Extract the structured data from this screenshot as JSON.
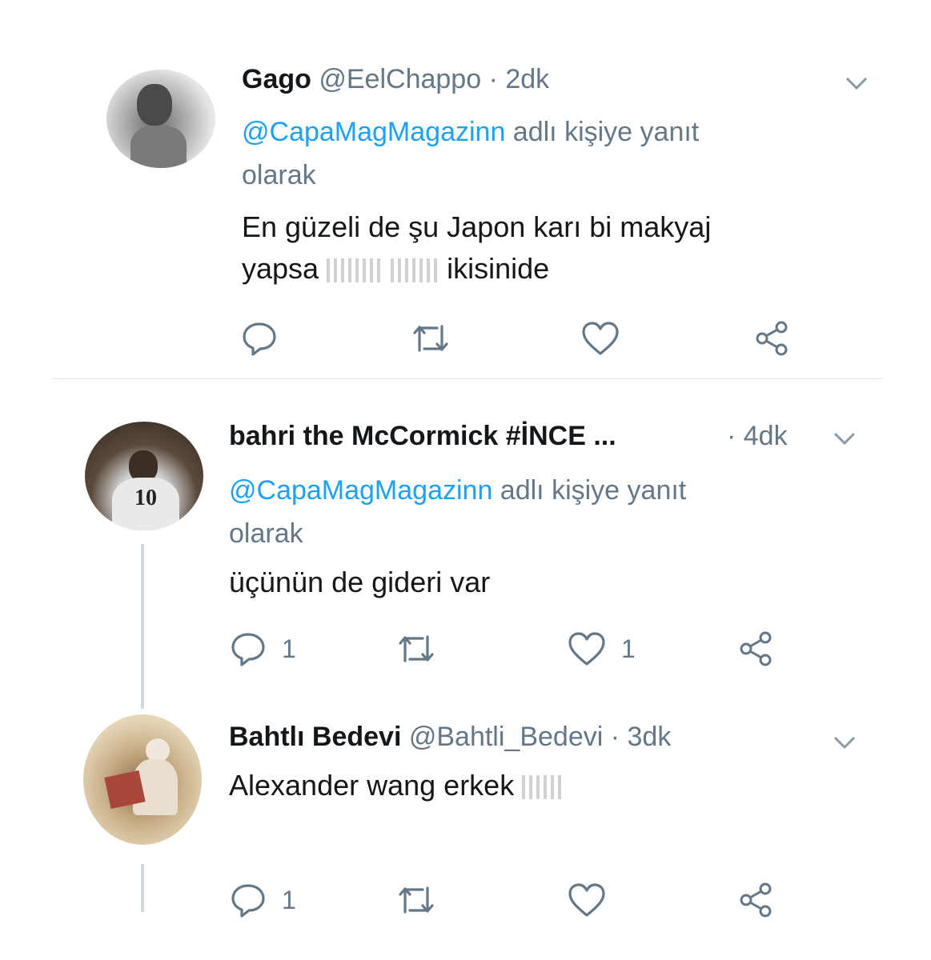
{
  "tweets": [
    {
      "name": "Gago",
      "handle": "@EelChappo",
      "time": "· 2dk",
      "reply_mention": "@CapaMagMagazinn",
      "reply_suffix": " adlı kişiye yanıt",
      "reply_line2": "olarak",
      "text_line1": "En güzeli de şu Japon karı bi makyaj",
      "text_line2_a": "yapsa",
      "text_line2_b": "ikisinide",
      "actions": {
        "reply": "",
        "retweet": "",
        "like": ""
      }
    },
    {
      "name": "bahri the McCormick #İNCE ...",
      "handle": "",
      "time": "· 4dk",
      "reply_mention": "@CapaMagMagazinn",
      "reply_suffix": " adlı kişiye yanıt",
      "reply_line2": "olarak",
      "text_line1": "üçünün de gideri var",
      "actions": {
        "reply": "1",
        "retweet": "",
        "like": "1"
      }
    },
    {
      "name": "Bahtlı Bedevi",
      "handle": "@Bahtli_Bedevi",
      "time": "· 3dk",
      "text_line1": "Alexander wang erkek",
      "actions": {
        "reply": "1",
        "retweet": "",
        "like": ""
      }
    }
  ],
  "icons": {
    "reply": "reply-icon",
    "retweet": "retweet-icon",
    "like": "heart-icon",
    "share": "share-icon",
    "menu": "chevron-down-icon"
  },
  "colors": {
    "mention": "#1da1f2",
    "secondary_text": "#657786",
    "primary_text": "#14171a"
  }
}
